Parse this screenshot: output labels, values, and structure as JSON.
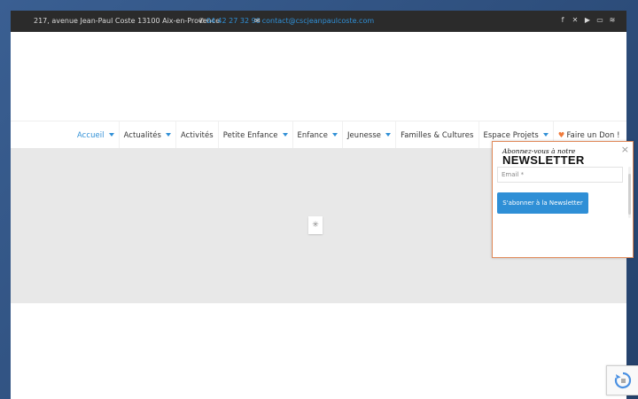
{
  "topbar": {
    "address": "217, avenue Jean-Paul Coste 13100 Aix-en-Provence",
    "phone": "04 42 27 32 96",
    "email": "contact@cscjeanpaulcoste.com",
    "socials": [
      "facebook-icon",
      "x-icon",
      "youtube-icon",
      "tv-icon",
      "rss-icon"
    ]
  },
  "nav": {
    "items": [
      {
        "label": "Accueil"
      },
      {
        "label": "Actualités"
      },
      {
        "label": "Activités"
      },
      {
        "label": "Petite Enfance"
      },
      {
        "label": "Enfance"
      },
      {
        "label": "Jeunesse"
      },
      {
        "label": "Familles & Cultures"
      },
      {
        "label": "Espace Projets"
      },
      {
        "label": "Faire un Don !"
      }
    ]
  },
  "popup": {
    "kicker": "Abonnez-vous à notre",
    "title": "NEWSLETTER",
    "email_placeholder": "Email *",
    "button_label": "S'abonner à la Newsletter",
    "close": "×"
  },
  "colors": {
    "accent": "#2f8fd6",
    "topbar_bg": "#2b2b2b",
    "heart": "#f07a3a",
    "popup_border": "#e08a5a"
  }
}
